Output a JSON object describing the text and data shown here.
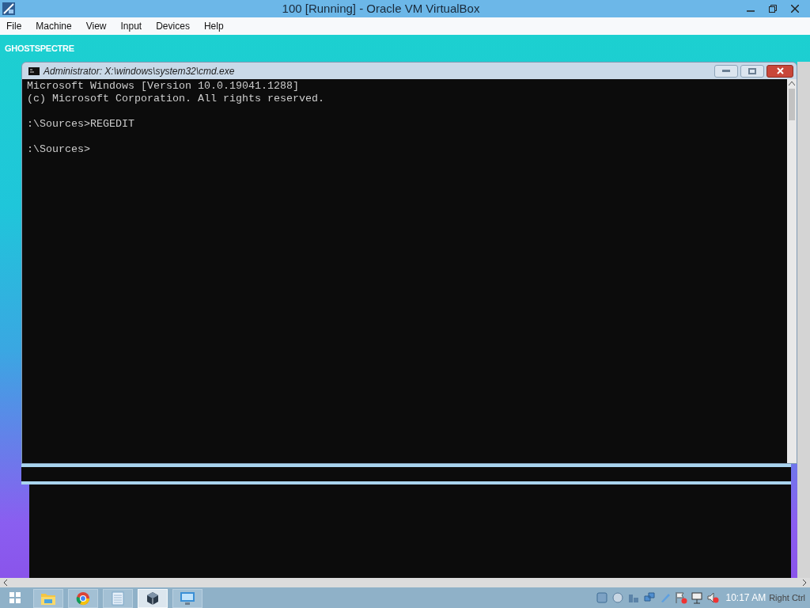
{
  "window": {
    "title": "100 [Running] - Oracle VM VirtualBox"
  },
  "menu": [
    "File",
    "Machine",
    "View",
    "Input",
    "Devices",
    "Help"
  ],
  "guest": {
    "banner": "GHOSTSPECTRE",
    "console": {
      "title": "Administrator: X:\\windows\\system32\\cmd.exe",
      "blocks": [
        [
          "Microsoft Windows [Version 10.0.19041.1288]",
          "(c) Microsoft Corporation. All rights reserved."
        ],
        [
          ":\\Sources>REGEDIT"
        ],
        [
          ":\\Sources>"
        ]
      ]
    }
  },
  "taskbar": {
    "apps": [
      {
        "kind": "folder",
        "selected": false
      },
      {
        "kind": "browser",
        "selected": false
      },
      {
        "kind": "notepad",
        "selected": false
      },
      {
        "kind": "cube",
        "selected": true
      },
      {
        "kind": "remote",
        "selected": false
      }
    ],
    "clock": "10:17 AM"
  },
  "status_bar": {
    "host_key": "Right Ctrl"
  }
}
